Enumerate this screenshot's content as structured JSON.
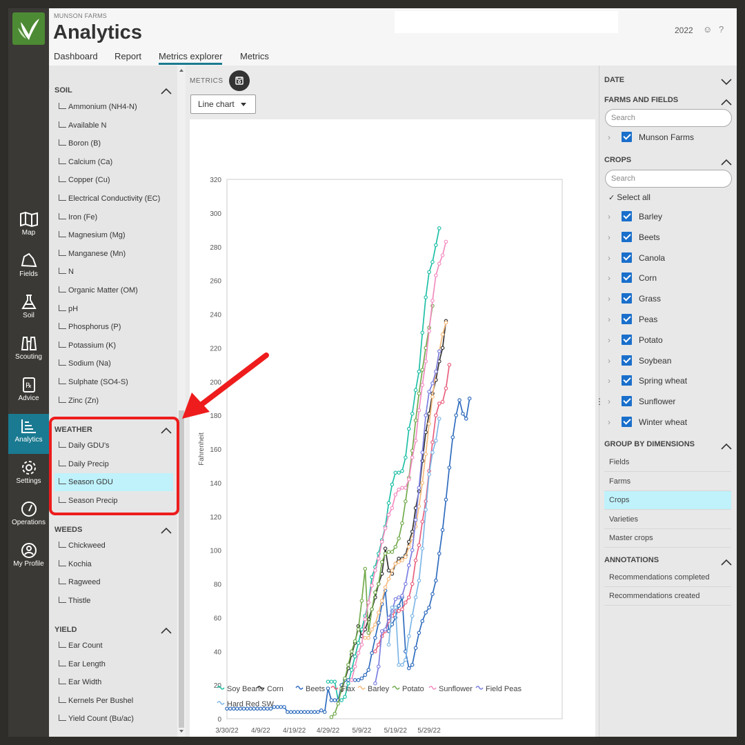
{
  "colors": {
    "accent": "#1a7a91",
    "annotation": "#ee1c1c",
    "selected_row": "#bff2fb",
    "checkbox": "#1a6fcb"
  },
  "nav": {
    "items": [
      {
        "label": "Map",
        "icon": "map-icon"
      },
      {
        "label": "Fields",
        "icon": "fields-icon"
      },
      {
        "label": "Soil",
        "icon": "flask-icon"
      },
      {
        "label": "Scouting",
        "icon": "binoculars-icon"
      },
      {
        "label": "Advice",
        "icon": "prescription-icon"
      },
      {
        "label": "Analytics",
        "icon": "chart-icon"
      },
      {
        "label": "Settings",
        "icon": "gear-icon"
      },
      {
        "label": "Operations",
        "icon": "gauge-icon"
      },
      {
        "label": "My Profile",
        "icon": "user-icon"
      }
    ]
  },
  "header": {
    "org": "MUNSON FARMS",
    "title": "Analytics",
    "year": "2022",
    "tabs": [
      "Dashboard",
      "Report",
      "Metrics explorer",
      "Metrics"
    ]
  },
  "metrics": {
    "soil": {
      "title": "SOIL",
      "items": [
        "Ammonium (NH4-N)",
        "Available N",
        "Boron (B)",
        "Calcium (Ca)",
        "Copper (Cu)",
        "Electrical Conductivity (EC)",
        "Iron (Fe)",
        "Magnesium (Mg)",
        "Manganese (Mn)",
        "N",
        "Organic Matter (OM)",
        "pH",
        "Phosphorus (P)",
        "Potassium (K)",
        "Sodium (Na)",
        "Sulphate (SO4-S)",
        "Zinc (Zn)"
      ]
    },
    "weather": {
      "title": "WEATHER",
      "items": [
        "Daily GDU's",
        "Daily Precip",
        "Season GDU",
        "Season Precip"
      ]
    },
    "weeds": {
      "title": "WEEDS",
      "items": [
        "Chickweed",
        "Kochia",
        "Ragweed",
        "Thistle"
      ]
    },
    "yield": {
      "title": "YIELD",
      "items": [
        "Ear Count",
        "Ear Length",
        "Ear Width",
        "Kernels Per Bushel",
        "Yield Count (Bu/ac)"
      ]
    }
  },
  "toolbar": {
    "metrics_label": "METRICS",
    "chart_type": "Line chart"
  },
  "chart_data": {
    "type": "line",
    "ylabel": "Fahrenheit",
    "ylim": [
      0,
      320
    ],
    "yticks": [
      "0",
      "20",
      "40",
      "60",
      "80",
      "100",
      "120",
      "140",
      "160",
      "180",
      "200",
      "220",
      "240",
      "260",
      "280",
      "300",
      "320"
    ],
    "xticks": [
      "3/30/22",
      "4/9/22",
      "4/19/22",
      "4/29/22",
      "5/9/22",
      "5/19/22",
      "5/29/22"
    ],
    "grid": false,
    "legend_position": "bottom",
    "series": [
      {
        "name": "Soy Beans",
        "color": "#1fbfa6",
        "start": "4/29/22",
        "values": [
          22,
          22,
          22,
          11,
          11,
          13,
          21,
          29,
          37,
          45,
          53,
          61,
          69,
          84,
          90,
          98,
          106,
          114,
          128,
          139,
          146,
          146,
          147,
          155,
          172,
          181,
          195,
          206,
          229,
          250,
          265,
          271,
          281,
          291
        ]
      },
      {
        "name": "Corn",
        "color": "#333333",
        "start": "5/2/22",
        "values": [
          11,
          17,
          23,
          30,
          38,
          45,
          55,
          49,
          53,
          59,
          65,
          72,
          80,
          86,
          101,
          88,
          86,
          92,
          95,
          95,
          97,
          105,
          111,
          125,
          135,
          153,
          170,
          181,
          193,
          201,
          212,
          220,
          236
        ]
      },
      {
        "name": "Beets",
        "color": "#2f6cbe",
        "start": "3/30/22",
        "values": [
          6,
          6,
          6,
          6,
          6,
          6,
          6,
          6,
          6,
          6,
          6,
          6,
          6,
          6,
          7,
          7,
          7,
          7,
          4,
          4,
          4,
          4,
          4,
          4,
          4,
          4,
          4,
          4,
          5,
          4,
          18,
          11,
          11,
          11,
          20,
          23,
          23,
          23,
          23,
          23,
          24,
          26,
          29,
          39,
          48,
          57,
          68,
          76,
          52,
          56,
          60,
          67,
          72,
          40,
          30,
          32,
          42,
          51,
          58,
          63,
          66,
          74,
          82,
          98,
          112,
          130,
          149,
          167,
          180,
          189,
          181,
          178,
          190
        ]
      },
      {
        "name": "Flax",
        "color": "#e8607e",
        "start": "5/13/22",
        "values": [
          40,
          44,
          49,
          52,
          58,
          61,
          64,
          64,
          65,
          69,
          72,
          80,
          94,
          103,
          117,
          129,
          147,
          164,
          180,
          187,
          188,
          196,
          210
        ]
      },
      {
        "name": "Barley",
        "color": "#f5ba7d",
        "start": "5/10/22",
        "values": [
          48,
          48,
          53,
          56,
          63,
          70,
          78,
          83,
          88,
          92,
          93,
          94,
          96,
          102,
          107,
          114,
          126,
          140,
          157,
          175,
          191,
          206,
          218,
          228,
          235
        ]
      },
      {
        "name": "Potato",
        "color": "#73ab4d",
        "start": "4/30/22",
        "values": [
          1,
          3,
          9,
          18,
          24,
          32,
          40,
          46,
          53,
          70,
          89,
          51,
          65,
          75,
          80,
          93,
          98,
          99,
          99,
          102,
          107,
          116,
          129,
          143,
          159,
          177,
          193,
          207,
          220,
          232,
          245
        ]
      },
      {
        "name": "Sunflower",
        "color": "#f28cc0",
        "start": "5/6/22",
        "values": [
          23,
          31,
          39,
          44,
          59,
          69,
          79,
          88,
          95,
          105,
          113,
          121,
          125,
          133,
          136,
          137,
          137,
          142,
          155,
          165,
          183,
          198,
          212,
          230,
          248,
          263,
          270,
          275,
          283
        ]
      },
      {
        "name": "Field Peas",
        "color": "#7b7fe0",
        "start": "5/13/22",
        "values": [
          21,
          31,
          52,
          53,
          60,
          64,
          71,
          72,
          73,
          80,
          91,
          100,
          118,
          137,
          158,
          180,
          194,
          199,
          206,
          218
        ]
      },
      {
        "name": "Hard Red SW",
        "color": "#7db6e6",
        "start": "5/17/22",
        "values": [
          44,
          66,
          66,
          32,
          32,
          35,
          49,
          61,
          72,
          82,
          101,
          124,
          145,
          158,
          165,
          178
        ]
      }
    ]
  },
  "filters": {
    "date": {
      "title": "DATE"
    },
    "farms": {
      "title": "FARMS AND FIELDS",
      "search_placeholder": "Search",
      "items": [
        "Munson Farms"
      ]
    },
    "crops": {
      "title": "CROPS",
      "search_placeholder": "Search",
      "select_all": "Select all",
      "items": [
        "Barley",
        "Beets",
        "Canola",
        "Corn",
        "Grass",
        "Peas",
        "Potato",
        "Soybean",
        "Spring wheat",
        "Sunflower",
        "Winter wheat"
      ]
    },
    "group_by": {
      "title": "GROUP BY DIMENSIONS",
      "items": [
        "Fields",
        "Farms",
        "Crops",
        "Varieties",
        "Master crops"
      ],
      "selected": "Crops"
    },
    "annotations": {
      "title": "ANNOTATIONS",
      "items": [
        "Recommendations completed",
        "Recommendations created"
      ]
    }
  }
}
